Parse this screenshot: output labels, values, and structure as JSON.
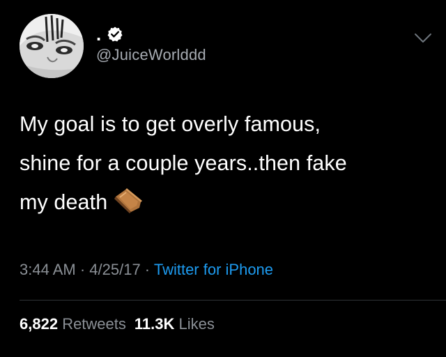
{
  "user": {
    "display_name": ".",
    "handle": "@JuiceWorlddd",
    "verified": true
  },
  "tweet": {
    "text_lines": [
      "My goal is to get overly famous,",
      "shine for a couple years..then fake",
      "my death"
    ],
    "emoji": "coffin-icon"
  },
  "meta": {
    "time": "3:44 AM",
    "sep1": " · ",
    "date": "4/25/17",
    "sep2": " · ",
    "source": "Twitter for iPhone"
  },
  "stats": {
    "retweets_count": "6,822",
    "retweets_label": "Retweets",
    "likes_count": "11.3K",
    "likes_label": "Likes"
  },
  "colors": {
    "background": "#000000",
    "text": "#ffffff",
    "secondary": "#8b9096",
    "link": "#1d9bf0"
  }
}
